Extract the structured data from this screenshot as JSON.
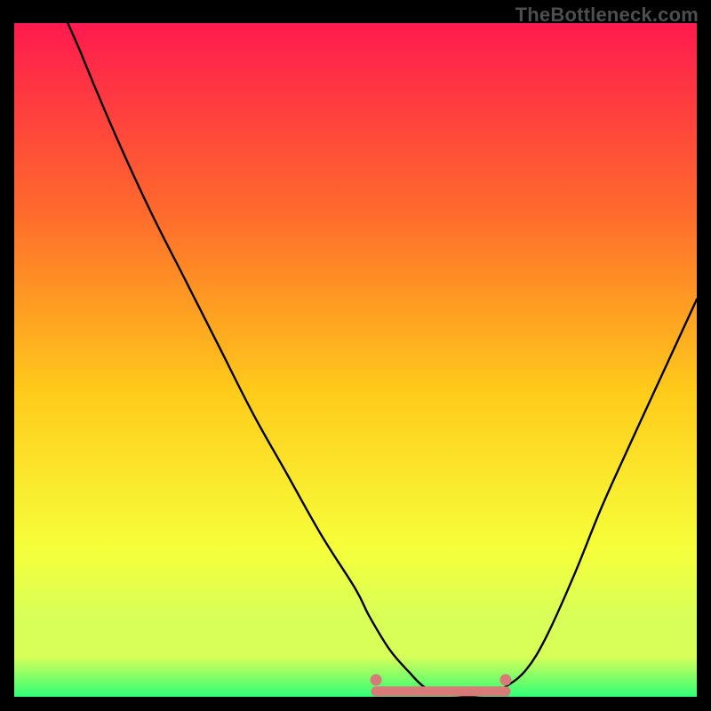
{
  "attribution": "TheBottleneck.com",
  "colors": {
    "page_bg": "#000000",
    "gradient_top": "#ff1a4e",
    "gradient_upper_mid": "#ff6a2c",
    "gradient_mid": "#ffcc1a",
    "gradient_lower_mid": "#f6ff3a",
    "gradient_low": "#d8ff58",
    "gradient_bottom": "#2fff77",
    "curve": "#000000",
    "band_stroke": "#d77a78",
    "watermark": "#4e4e4e"
  },
  "chart_data": {
    "type": "line",
    "title": "",
    "xlabel": "",
    "ylabel": "",
    "xlim": [
      0,
      100
    ],
    "ylim": [
      0,
      100
    ],
    "series": [
      {
        "name": "bottleneck-curve",
        "x": [
          0,
          5,
          10,
          15,
          20,
          25,
          30,
          35,
          40,
          45,
          50,
          52,
          55,
          58,
          60,
          62,
          65,
          68,
          70,
          72,
          75,
          78,
          82,
          86,
          90,
          95,
          100
        ],
        "y": [
          130,
          108,
          95,
          83,
          72,
          62,
          52,
          42,
          33,
          24,
          16,
          12,
          7,
          3.5,
          1.5,
          0.6,
          0.2,
          0.2,
          0.6,
          1.5,
          4,
          9,
          18,
          28,
          37,
          48,
          59
        ]
      }
    ],
    "optimal_band": {
      "x_start": 53,
      "x_end": 72,
      "y": 0.8,
      "endpoint_y": 2.5
    },
    "gradient_stops_pct": [
      0,
      28,
      55,
      78,
      88,
      94,
      100
    ]
  }
}
